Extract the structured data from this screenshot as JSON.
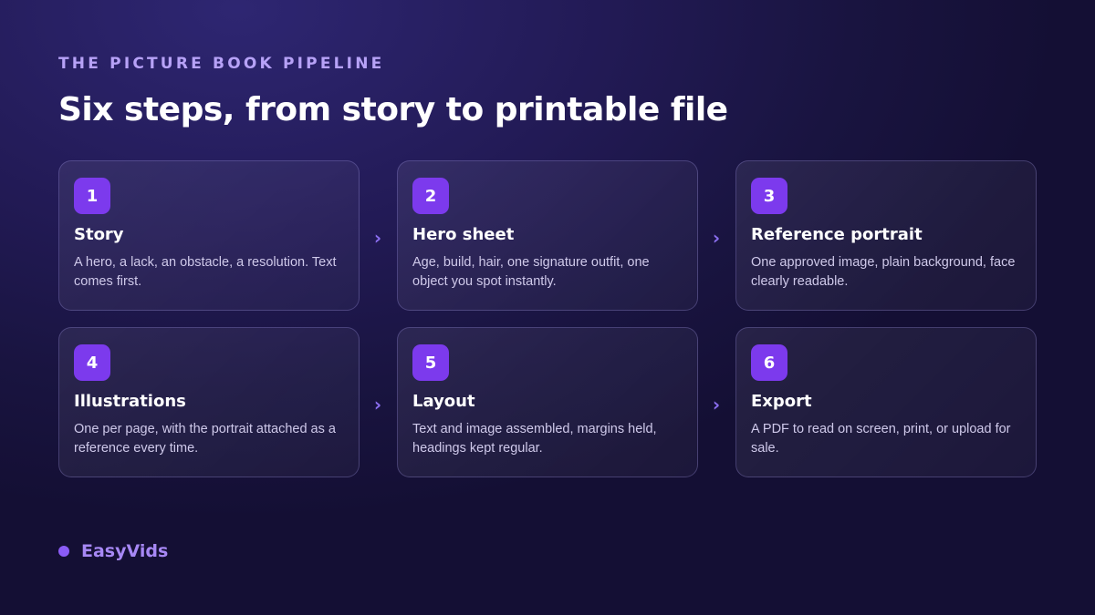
{
  "header": {
    "eyebrow": "THE PICTURE BOOK PIPELINE",
    "title": "Six steps, from story to printable file"
  },
  "steps": [
    {
      "number": "1",
      "title": "Story",
      "description": "A hero, a lack, an obstacle, a resolution. Text comes first."
    },
    {
      "number": "2",
      "title": "Hero sheet",
      "description": "Age, build, hair, one signature outfit, one object you spot instantly."
    },
    {
      "number": "3",
      "title": "Reference portrait",
      "description": "One approved image, plain background, face clearly readable."
    },
    {
      "number": "4",
      "title": "Illustrations",
      "description": "One per page, with the portrait attached as a reference every time."
    },
    {
      "number": "5",
      "title": "Layout",
      "description": "Text and image assembled, margins held, headings kept regular."
    },
    {
      "number": "6",
      "title": "Export",
      "description": "A PDF to read on screen, print, or upload for sale."
    }
  ],
  "arrow_glyph": "›",
  "arrow_icon": "chevron-right-icon",
  "brand": {
    "name": "EasyVids",
    "dot_icon": "brand-dot-icon"
  },
  "colors": {
    "accent": "#7c3aed",
    "eyebrow": "#b7a2f7",
    "brand": "#a788f5",
    "background": "#1e1850"
  }
}
